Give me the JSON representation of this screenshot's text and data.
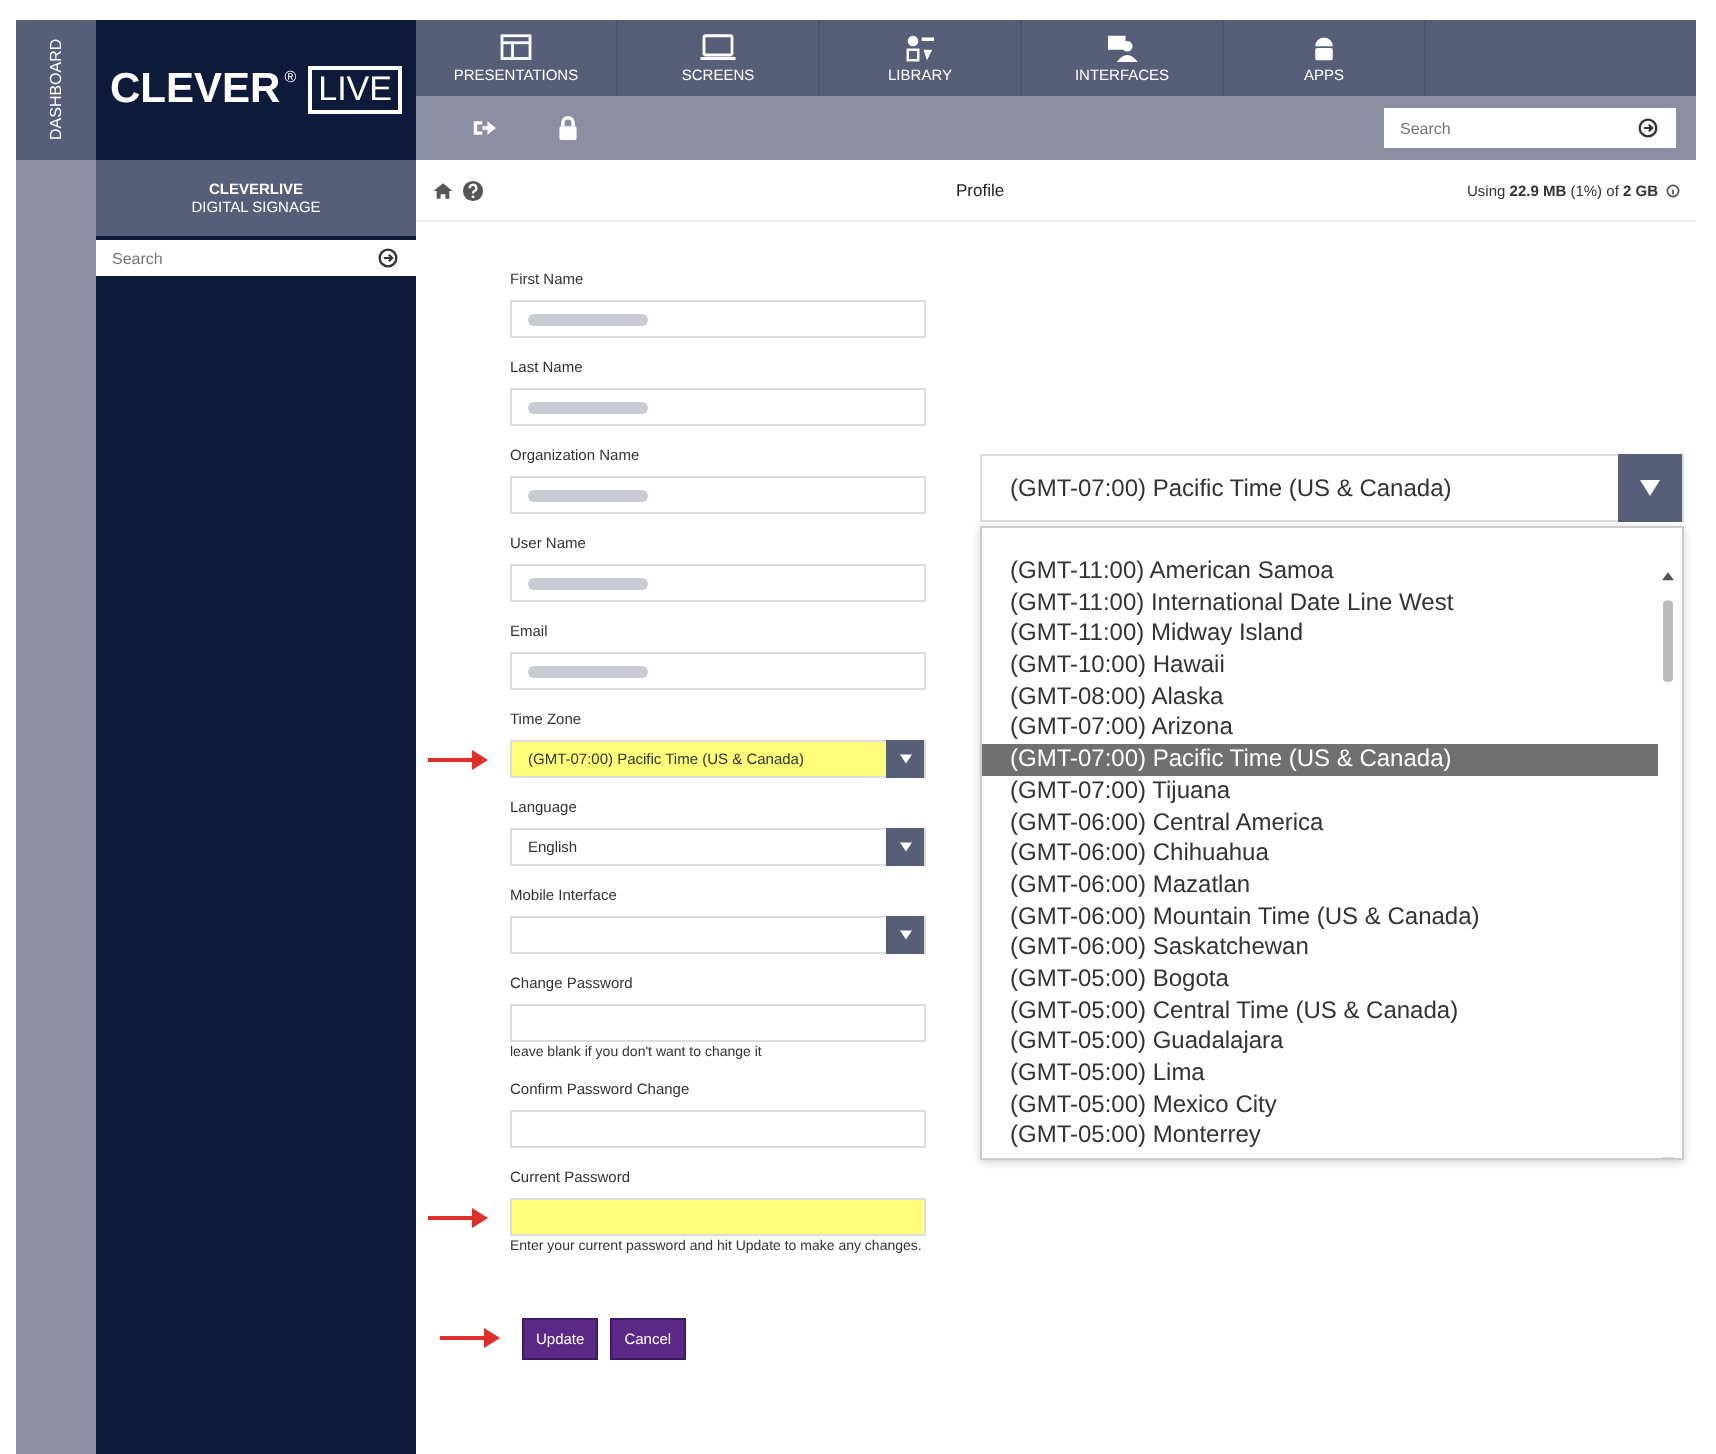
{
  "dashboard_tab": {
    "label": "DASHBOARD"
  },
  "logo": {
    "word": "CLEVER",
    "mark": "®",
    "bracket_word": "LIVE"
  },
  "nav": [
    {
      "label": "PRESENTATIONS"
    },
    {
      "label": "SCREENS"
    },
    {
      "label": "LIBRARY"
    },
    {
      "label": "INTERFACES"
    },
    {
      "label": "APPS"
    }
  ],
  "toolbar": {
    "search": {
      "placeholder": "Search"
    }
  },
  "sidebar": {
    "title": "CLEVERLIVE",
    "subtitle": "DIGITAL SIGNAGE",
    "search": {
      "placeholder": "Search"
    }
  },
  "page": {
    "title": "Profile",
    "usage": "Using **22.9 MB** (1%) of **2 GB**"
  },
  "fields": [
    {
      "label": "First Name",
      "kind": "blurred",
      "highlighted": false,
      "arrow": false
    },
    {
      "label": "Last Name",
      "kind": "blurred",
      "highlighted": false,
      "arrow": false
    },
    {
      "label": "Organization Name",
      "kind": "blurred",
      "highlighted": false,
      "arrow": false
    },
    {
      "label": "User Name",
      "kind": "blurred",
      "highlighted": false,
      "arrow": false
    },
    {
      "label": "Email",
      "kind": "blurred",
      "highlighted": false,
      "arrow": false
    },
    {
      "label": "Time Zone",
      "kind": "select",
      "value": "(GMT-07:00) Pacific Time (US & Canada)",
      "highlighted": true,
      "arrow": true
    },
    {
      "label": "Language",
      "kind": "select",
      "value": "English",
      "highlighted": false,
      "arrow": false
    },
    {
      "label": "Mobile Interface",
      "kind": "select",
      "highlighted": false,
      "arrow": false
    },
    {
      "label": "Change Password",
      "kind": "password",
      "hint": "leave blank if you don't want to change it",
      "highlighted": false,
      "arrow": false
    },
    {
      "label": "Confirm Password Change",
      "kind": "password",
      "highlighted": false,
      "arrow": false
    },
    {
      "label": "Current Password",
      "kind": "password",
      "hint": "Enter your current password and hit Update to make any changes.",
      "highlighted": true,
      "arrow": true
    }
  ],
  "buttons": [
    {
      "label": "Update",
      "arrow": true
    },
    {
      "label": "Cancel",
      "arrow": false
    }
  ],
  "timezone_dropdown": {
    "value": "(GMT-07:00) Pacific Time (US & Canada)",
    "options": [
      {
        "label": "(GMT-11:00) American Samoa",
        "selected": false
      },
      {
        "label": "(GMT-11:00) International Date Line West",
        "selected": false
      },
      {
        "label": "(GMT-11:00) Midway Island",
        "selected": false
      },
      {
        "label": "(GMT-10:00) Hawaii",
        "selected": false
      },
      {
        "label": "(GMT-08:00) Alaska",
        "selected": false
      },
      {
        "label": "(GMT-07:00) Arizona",
        "selected": false
      },
      {
        "label": "(GMT-07:00) Pacific Time (US & Canada)",
        "selected": true
      },
      {
        "label": "(GMT-07:00) Tijuana",
        "selected": false
      },
      {
        "label": "(GMT-06:00) Central America",
        "selected": false
      },
      {
        "label": "(GMT-06:00) Chihuahua",
        "selected": false
      },
      {
        "label": "(GMT-06:00) Mazatlan",
        "selected": false
      },
      {
        "label": "(GMT-06:00) Mountain Time (US & Canada)",
        "selected": false
      },
      {
        "label": "(GMT-06:00) Saskatchewan",
        "selected": false
      },
      {
        "label": "(GMT-05:00) Bogota",
        "selected": false
      },
      {
        "label": "(GMT-05:00) Central Time (US & Canada)",
        "selected": false
      },
      {
        "label": "(GMT-05:00) Guadalajara",
        "selected": false
      },
      {
        "label": "(GMT-05:00) Lima",
        "selected": false
      },
      {
        "label": "(GMT-05:00) Mexico City",
        "selected": false
      },
      {
        "label": "(GMT-05:00) Monterrey",
        "selected": false
      }
    ]
  }
}
